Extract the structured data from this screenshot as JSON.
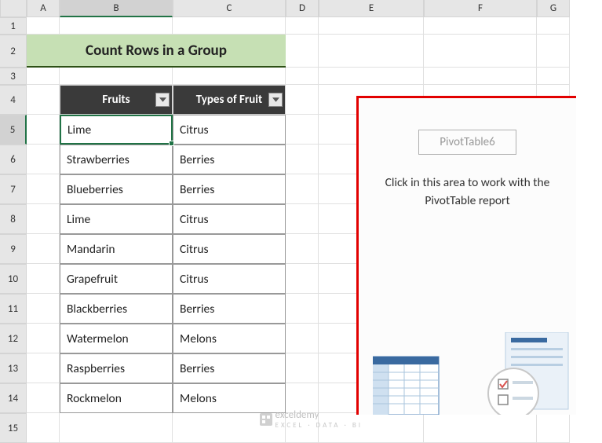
{
  "columns": [
    "A",
    "B",
    "C",
    "D",
    "E",
    "F",
    "G"
  ],
  "rows": [
    "1",
    "2",
    "3",
    "4",
    "5",
    "6",
    "7",
    "8",
    "9",
    "10",
    "11",
    "12",
    "13",
    "14",
    "15"
  ],
  "title": "Count Rows in a Group",
  "headers": {
    "fruits": "Fruits",
    "types": "Types of Fruit"
  },
  "data": [
    {
      "fruit": "Lime",
      "type": "Citrus"
    },
    {
      "fruit": "Strawberries",
      "type": "Berries"
    },
    {
      "fruit": "Blueberries",
      "type": "Berries"
    },
    {
      "fruit": "Lime",
      "type": "Citrus"
    },
    {
      "fruit": "Mandarin",
      "type": "Citrus"
    },
    {
      "fruit": "Grapefruit",
      "type": "Citrus"
    },
    {
      "fruit": "Blackberries",
      "type": "Berries"
    },
    {
      "fruit": "Watermelon",
      "type": "Melons"
    },
    {
      "fruit": "Raspberries",
      "type": "Berries"
    },
    {
      "fruit": "Rockmelon",
      "type": "Melons"
    }
  ],
  "pivot": {
    "name": "PivotTable6",
    "message": "Click in this area to work with the PivotTable report"
  },
  "watermark": {
    "brand": "exceldemy",
    "sub": "EXCEL · DATA · BI"
  },
  "chart_data": {
    "type": "table",
    "title": "Count Rows in a Group",
    "columns": [
      "Fruits",
      "Types of Fruit"
    ],
    "rows": [
      [
        "Lime",
        "Citrus"
      ],
      [
        "Strawberries",
        "Berries"
      ],
      [
        "Blueberries",
        "Berries"
      ],
      [
        "Lime",
        "Citrus"
      ],
      [
        "Mandarin",
        "Citrus"
      ],
      [
        "Grapefruit",
        "Citrus"
      ],
      [
        "Blackberries",
        "Berries"
      ],
      [
        "Watermelon",
        "Melons"
      ],
      [
        "Raspberries",
        "Berries"
      ],
      [
        "Rockmelon",
        "Melons"
      ]
    ]
  }
}
